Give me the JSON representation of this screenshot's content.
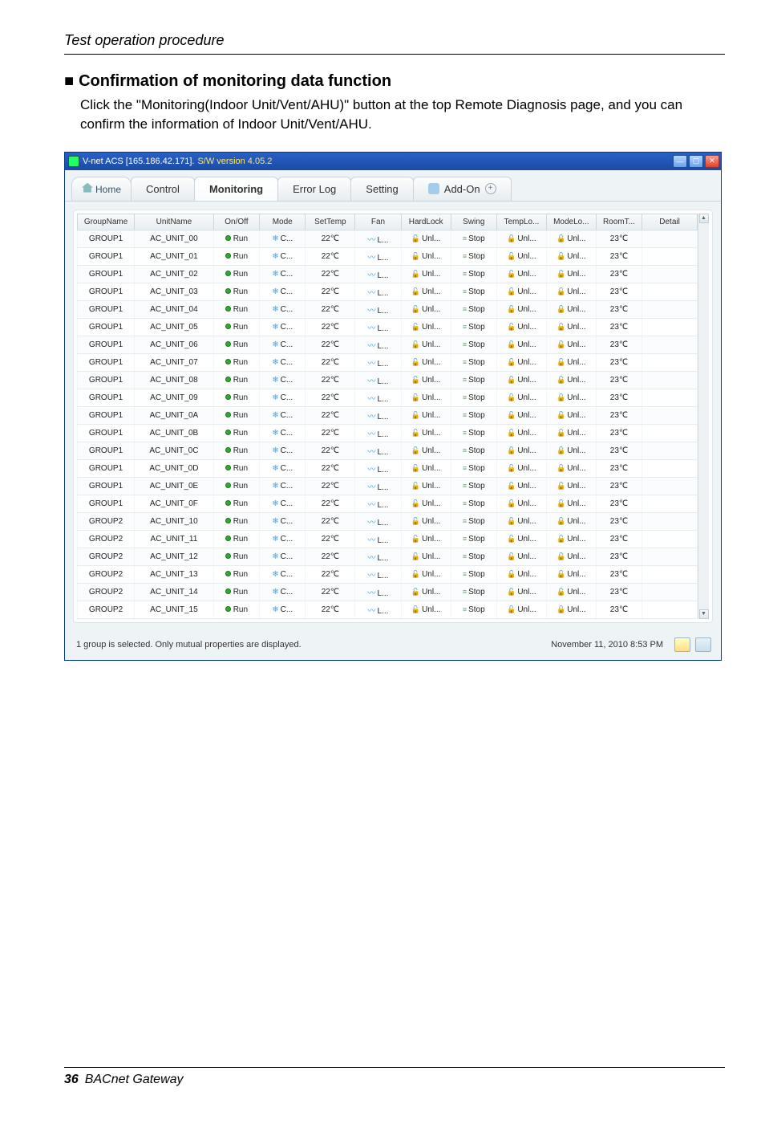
{
  "doc": {
    "header": "Test operation procedure",
    "footer_page": "36",
    "footer_text": "BACnet Gateway"
  },
  "section": {
    "heading": "Confirmation of monitoring data function",
    "body": "Click the \"Monitoring(Indoor Unit/Vent/AHU)\" button at the top Remote Diagnosis page, and you can confirm the information of Indoor Unit/Vent/AHU."
  },
  "window": {
    "title_prefix": "V-net ACS [165.186.42.171].",
    "title_version": "S/W version 4.05.2",
    "tabs": {
      "home": "Home",
      "control": "Control",
      "monitoring": "Monitoring",
      "errorlog": "Error Log",
      "setting": "Setting",
      "addon": "Add-On"
    },
    "status_left": "1 group is selected. Only mutual properties are displayed.",
    "status_right": "November 11, 2010  8:53 PM"
  },
  "table": {
    "headers": [
      "GroupName",
      "UnitName",
      "On/Off",
      "Mode",
      "SetTemp",
      "Fan",
      "HardLock",
      "Swing",
      "TempLo...",
      "ModeLo...",
      "RoomT...",
      "Detail"
    ],
    "rows": [
      {
        "group": "GROUP1",
        "unit": "AC_UNIT_00",
        "onoff": "Run",
        "mode": "C...",
        "settemp": "22℃",
        "fan": "L...",
        "hardlock": "Unl...",
        "swing": "Stop",
        "templo": "Unl...",
        "modelo": "Unl...",
        "roomt": "23℃",
        "detail": ""
      },
      {
        "group": "GROUP1",
        "unit": "AC_UNIT_01",
        "onoff": "Run",
        "mode": "C...",
        "settemp": "22℃",
        "fan": "L...",
        "hardlock": "Unl...",
        "swing": "Stop",
        "templo": "Unl...",
        "modelo": "Unl...",
        "roomt": "23℃",
        "detail": ""
      },
      {
        "group": "GROUP1",
        "unit": "AC_UNIT_02",
        "onoff": "Run",
        "mode": "C...",
        "settemp": "22℃",
        "fan": "L...",
        "hardlock": "Unl...",
        "swing": "Stop",
        "templo": "Unl...",
        "modelo": "Unl...",
        "roomt": "23℃",
        "detail": ""
      },
      {
        "group": "GROUP1",
        "unit": "AC_UNIT_03",
        "onoff": "Run",
        "mode": "C...",
        "settemp": "22℃",
        "fan": "L...",
        "hardlock": "Unl...",
        "swing": "Stop",
        "templo": "Unl...",
        "modelo": "Unl...",
        "roomt": "23℃",
        "detail": ""
      },
      {
        "group": "GROUP1",
        "unit": "AC_UNIT_04",
        "onoff": "Run",
        "mode": "C...",
        "settemp": "22℃",
        "fan": "L...",
        "hardlock": "Unl...",
        "swing": "Stop",
        "templo": "Unl...",
        "modelo": "Unl...",
        "roomt": "23℃",
        "detail": ""
      },
      {
        "group": "GROUP1",
        "unit": "AC_UNIT_05",
        "onoff": "Run",
        "mode": "C...",
        "settemp": "22℃",
        "fan": "L...",
        "hardlock": "Unl...",
        "swing": "Stop",
        "templo": "Unl...",
        "modelo": "Unl...",
        "roomt": "23℃",
        "detail": ""
      },
      {
        "group": "GROUP1",
        "unit": "AC_UNIT_06",
        "onoff": "Run",
        "mode": "C...",
        "settemp": "22℃",
        "fan": "L...",
        "hardlock": "Unl...",
        "swing": "Stop",
        "templo": "Unl...",
        "modelo": "Unl...",
        "roomt": "23℃",
        "detail": ""
      },
      {
        "group": "GROUP1",
        "unit": "AC_UNIT_07",
        "onoff": "Run",
        "mode": "C...",
        "settemp": "22℃",
        "fan": "L...",
        "hardlock": "Unl...",
        "swing": "Stop",
        "templo": "Unl...",
        "modelo": "Unl...",
        "roomt": "23℃",
        "detail": ""
      },
      {
        "group": "GROUP1",
        "unit": "AC_UNIT_08",
        "onoff": "Run",
        "mode": "C...",
        "settemp": "22℃",
        "fan": "L...",
        "hardlock": "Unl...",
        "swing": "Stop",
        "templo": "Unl...",
        "modelo": "Unl...",
        "roomt": "23℃",
        "detail": ""
      },
      {
        "group": "GROUP1",
        "unit": "AC_UNIT_09",
        "onoff": "Run",
        "mode": "C...",
        "settemp": "22℃",
        "fan": "L...",
        "hardlock": "Unl...",
        "swing": "Stop",
        "templo": "Unl...",
        "modelo": "Unl...",
        "roomt": "23℃",
        "detail": ""
      },
      {
        "group": "GROUP1",
        "unit": "AC_UNIT_0A",
        "onoff": "Run",
        "mode": "C...",
        "settemp": "22℃",
        "fan": "L...",
        "hardlock": "Unl...",
        "swing": "Stop",
        "templo": "Unl...",
        "modelo": "Unl...",
        "roomt": "23℃",
        "detail": ""
      },
      {
        "group": "GROUP1",
        "unit": "AC_UNIT_0B",
        "onoff": "Run",
        "mode": "C...",
        "settemp": "22℃",
        "fan": "L...",
        "hardlock": "Unl...",
        "swing": "Stop",
        "templo": "Unl...",
        "modelo": "Unl...",
        "roomt": "23℃",
        "detail": ""
      },
      {
        "group": "GROUP1",
        "unit": "AC_UNIT_0C",
        "onoff": "Run",
        "mode": "C...",
        "settemp": "22℃",
        "fan": "L...",
        "hardlock": "Unl...",
        "swing": "Stop",
        "templo": "Unl...",
        "modelo": "Unl...",
        "roomt": "23℃",
        "detail": ""
      },
      {
        "group": "GROUP1",
        "unit": "AC_UNIT_0D",
        "onoff": "Run",
        "mode": "C...",
        "settemp": "22℃",
        "fan": "L...",
        "hardlock": "Unl...",
        "swing": "Stop",
        "templo": "Unl...",
        "modelo": "Unl...",
        "roomt": "23℃",
        "detail": ""
      },
      {
        "group": "GROUP1",
        "unit": "AC_UNIT_0E",
        "onoff": "Run",
        "mode": "C...",
        "settemp": "22℃",
        "fan": "L...",
        "hardlock": "Unl...",
        "swing": "Stop",
        "templo": "Unl...",
        "modelo": "Unl...",
        "roomt": "23℃",
        "detail": ""
      },
      {
        "group": "GROUP1",
        "unit": "AC_UNIT_0F",
        "onoff": "Run",
        "mode": "C...",
        "settemp": "22℃",
        "fan": "L...",
        "hardlock": "Unl...",
        "swing": "Stop",
        "templo": "Unl...",
        "modelo": "Unl...",
        "roomt": "23℃",
        "detail": ""
      },
      {
        "group": "GROUP2",
        "unit": "AC_UNIT_10",
        "onoff": "Run",
        "mode": "C...",
        "settemp": "22℃",
        "fan": "L...",
        "hardlock": "Unl...",
        "swing": "Stop",
        "templo": "Unl...",
        "modelo": "Unl...",
        "roomt": "23℃",
        "detail": ""
      },
      {
        "group": "GROUP2",
        "unit": "AC_UNIT_11",
        "onoff": "Run",
        "mode": "C...",
        "settemp": "22℃",
        "fan": "L...",
        "hardlock": "Unl...",
        "swing": "Stop",
        "templo": "Unl...",
        "modelo": "Unl...",
        "roomt": "23℃",
        "detail": ""
      },
      {
        "group": "GROUP2",
        "unit": "AC_UNIT_12",
        "onoff": "Run",
        "mode": "C...",
        "settemp": "22℃",
        "fan": "L...",
        "hardlock": "Unl...",
        "swing": "Stop",
        "templo": "Unl...",
        "modelo": "Unl...",
        "roomt": "23℃",
        "detail": ""
      },
      {
        "group": "GROUP2",
        "unit": "AC_UNIT_13",
        "onoff": "Run",
        "mode": "C...",
        "settemp": "22℃",
        "fan": "L...",
        "hardlock": "Unl...",
        "swing": "Stop",
        "templo": "Unl...",
        "modelo": "Unl...",
        "roomt": "23℃",
        "detail": ""
      },
      {
        "group": "GROUP2",
        "unit": "AC_UNIT_14",
        "onoff": "Run",
        "mode": "C...",
        "settemp": "22℃",
        "fan": "L...",
        "hardlock": "Unl...",
        "swing": "Stop",
        "templo": "Unl...",
        "modelo": "Unl...",
        "roomt": "23℃",
        "detail": ""
      },
      {
        "group": "GROUP2",
        "unit": "AC_UNIT_15",
        "onoff": "Run",
        "mode": "C...",
        "settemp": "22℃",
        "fan": "L...",
        "hardlock": "Unl...",
        "swing": "Stop",
        "templo": "Unl...",
        "modelo": "Unl...",
        "roomt": "23℃",
        "detail": ""
      }
    ]
  }
}
